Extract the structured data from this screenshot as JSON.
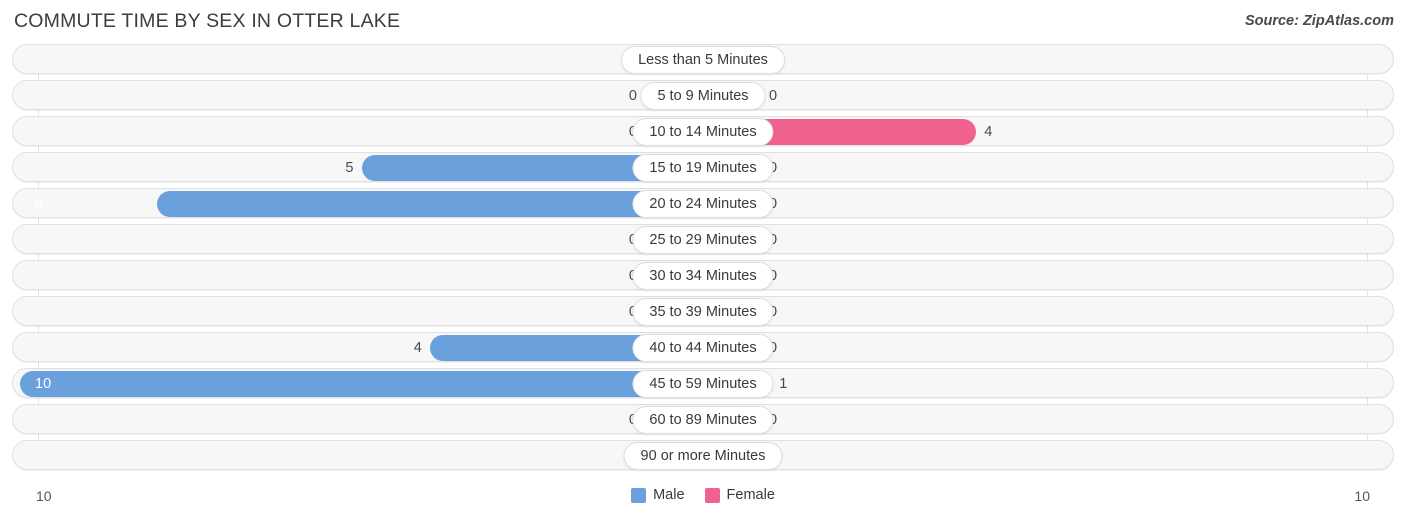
{
  "header": {
    "title": "COMMUTE TIME BY SEX IN OTTER LAKE",
    "source": "Source: ZipAtlas.com"
  },
  "legend": {
    "male_label": "Male",
    "female_label": "Female",
    "male_color": "#6aa0dc",
    "female_color": "#f0628e"
  },
  "axis": {
    "left_label": "10",
    "right_label": "10"
  },
  "colors": {
    "male_active": "#6aa0dc",
    "male_zero": "#a9c9ea",
    "female_active": "#f0628e",
    "female_zero": "#f7aecb",
    "row_track": "#f7f7f7",
    "row_border": "#e0e0e0"
  },
  "chart_data": {
    "type": "bar",
    "subtype": "diverging-horizontal-bar",
    "title": "COMMUTE TIME BY SEX IN OTTER LAKE",
    "xlabel": "",
    "ylabel": "",
    "xlim": [
      10,
      10
    ],
    "axis_max": 10,
    "grid": true,
    "legend_position": "bottom-center",
    "categories": [
      "Less than 5 Minutes",
      "5 to 9 Minutes",
      "10 to 14 Minutes",
      "15 to 19 Minutes",
      "20 to 24 Minutes",
      "25 to 29 Minutes",
      "30 to 34 Minutes",
      "35 to 39 Minutes",
      "40 to 44 Minutes",
      "45 to 59 Minutes",
      "60 to 89 Minutes",
      "90 or more Minutes"
    ],
    "series": [
      {
        "name": "Male",
        "values": [
          0,
          0,
          0,
          5,
          8,
          0,
          0,
          0,
          4,
          10,
          0,
          0
        ]
      },
      {
        "name": "Female",
        "values": [
          0,
          0,
          4,
          0,
          0,
          0,
          0,
          0,
          0,
          1,
          0,
          0
        ]
      }
    ],
    "male_labels": [
      "0",
      "0",
      "0",
      "5",
      "8",
      "0",
      "0",
      "0",
      "4",
      "10",
      "0",
      "0"
    ],
    "female_labels": [
      "0",
      "0",
      "4",
      "0",
      "0",
      "0",
      "0",
      "0",
      "0",
      "1",
      "0",
      "0"
    ]
  }
}
